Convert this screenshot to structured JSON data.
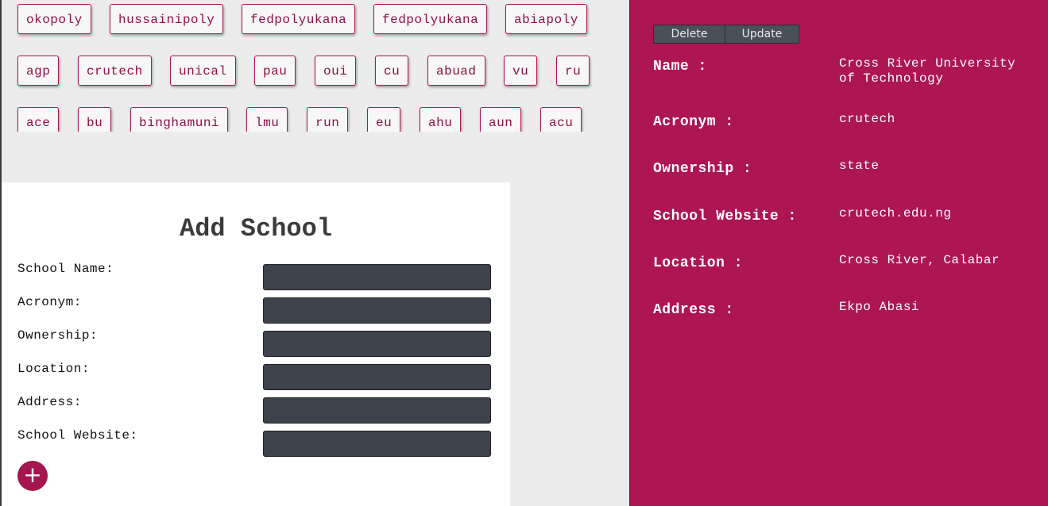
{
  "schools": {
    "row1": [
      "okopoly",
      "hussainipoly",
      "fedpolyukana",
      "fedpolyukana",
      "abiapoly"
    ],
    "row2": [
      "agp",
      "crutech",
      "unical",
      "pau",
      "oui",
      "cu",
      "abuad",
      "vu",
      "ru"
    ],
    "row3": [
      "ace",
      "bu",
      "binghamuni",
      "lmu",
      "run",
      "eu",
      "ahu",
      "aun",
      "acu"
    ]
  },
  "form": {
    "title": "Add School",
    "fields": [
      {
        "label": "School Name:",
        "value": ""
      },
      {
        "label": "Acronym:",
        "value": ""
      },
      {
        "label": "Ownership:",
        "value": ""
      },
      {
        "label": "Location:",
        "value": ""
      },
      {
        "label": "Address:",
        "value": ""
      },
      {
        "label": "School Website:",
        "value": ""
      }
    ],
    "add_button": "+"
  },
  "detail": {
    "delete_label": "Delete",
    "update_label": "Update",
    "rows": [
      {
        "label": "Name :",
        "value": "Cross River University of Technology"
      },
      {
        "label": "Acronym :",
        "value": "crutech"
      },
      {
        "label": "Ownership :",
        "value": "state"
      },
      {
        "label": "School Website :",
        "value": "crutech.edu.ng"
      },
      {
        "label": "Location :",
        "value": "Cross River, Calabar"
      },
      {
        "label": "Address :",
        "value": "Ekpo Abasi"
      }
    ]
  },
  "colors": {
    "accent": "#ad1553",
    "input_bg": "#3d424c",
    "page_bg": "#ececec"
  }
}
